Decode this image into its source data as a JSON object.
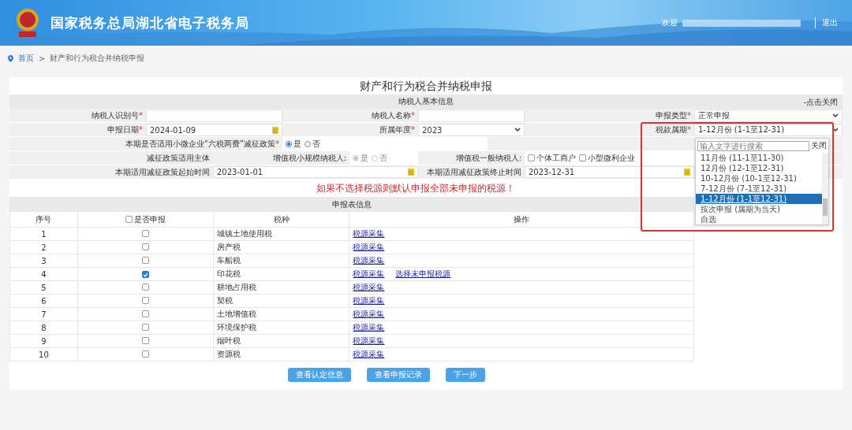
{
  "header": {
    "title": "国家税务总局湖北省电子税务局",
    "welcome": "欢迎",
    "logout": "退出"
  },
  "breadcrumb": {
    "home": "首页",
    "separator": ">",
    "current": "财产和行为税合并纳税申报"
  },
  "form": {
    "title": "财产和行为税合并纳税申报",
    "basic_info": {
      "title": "纳税人基本信息",
      "toggle": "-点击关闭",
      "fields": [
        {
          "label": "纳税人识别号",
          "mark": "*",
          "kind": "text"
        },
        {
          "label": "纳税人名称",
          "mark": "*",
          "kind": "text"
        },
        {
          "label": "申报类型",
          "mark": "*",
          "kind": "select",
          "value": "正常申报"
        },
        {
          "label": "申报日期",
          "mark": "*",
          "kind": "date",
          "value": "2024-01-09"
        },
        {
          "label": "所属年度",
          "mark": "*",
          "kind": "select",
          "value": "2023"
        },
        {
          "label": "税款属期",
          "mark": "*",
          "kind": "select",
          "value": "1-12月份 (1-1至12-31)",
          "highlighted": true
        },
        {
          "label": "本期是否适用小微企业“六税两费”减征政策",
          "mark": "*",
          "kind": "radio",
          "disabled": false,
          "options": [
            {
              "label": "是",
              "selected": true
            },
            {
              "label": "否",
              "selected": false
            }
          ]
        },
        {
          "label": "减征政策适用主体",
          "kind": "caption"
        },
        {
          "label": "增值税小规模纳税人:",
          "kind": "radio",
          "disabled": true,
          "options": [
            {
              "label": "是",
              "selected": true
            },
            {
              "label": "否",
              "selected": false
            }
          ]
        },
        {
          "label": "增值税一般纳税人:",
          "kind": "checkbox",
          "options": [
            {
              "label": "个体工商户",
              "checked": false
            },
            {
              "label": "小型微利企业",
              "checked": false
            }
          ]
        },
        {
          "label": "本期适用减征政策起始时间",
          "kind": "date",
          "value": "2023-01-01"
        },
        {
          "label": "本期适用减征政策终止时间",
          "kind": "date",
          "value": "2023-12-31"
        }
      ]
    },
    "period_dropdown": {
      "open": true,
      "search_placeholder": "输入文字进行搜索",
      "close": "关闭",
      "options": [
        {
          "label": "11月份 (11-1至11-30)",
          "selected": false
        },
        {
          "label": "12月份 (12-1至12-31)",
          "selected": false
        },
        {
          "label": "10-12月份 (10-1至12-31)",
          "selected": false
        },
        {
          "label": "7-12月份 (7-1至12-31)",
          "selected": false
        },
        {
          "label": "1-12月份 (1-1至12-31)",
          "selected": true
        },
        {
          "label": "按次申报 (属期为当天)",
          "selected": false
        },
        {
          "label": "自选",
          "selected": false
        }
      ]
    },
    "notice": "如果不选择税源则默认申报全部未申报的税源！",
    "table": {
      "title": "申报表信息",
      "columns": [
        {
          "label": "序号"
        },
        {
          "label": "是否申报",
          "kind": "checkbox",
          "checked": false
        },
        {
          "label": "税种"
        },
        {
          "label": "操作"
        }
      ],
      "rows": [
        {
          "no": "1",
          "checked": false,
          "tax": "城镇土地使用税",
          "actions": [
            "税源采集"
          ]
        },
        {
          "no": "2",
          "checked": false,
          "tax": "房产税",
          "actions": [
            "税源采集"
          ]
        },
        {
          "no": "3",
          "checked": false,
          "tax": "车船税",
          "actions": [
            "税源采集"
          ]
        },
        {
          "no": "4",
          "checked": true,
          "tax": "印花税",
          "actions": [
            "税源采集",
            "选择未申报税源"
          ]
        },
        {
          "no": "5",
          "checked": false,
          "tax": "耕地占用税",
          "actions": [
            "税源采集"
          ]
        },
        {
          "no": "6",
          "checked": false,
          "tax": "契税",
          "actions": [
            "税源采集"
          ]
        },
        {
          "no": "7",
          "checked": false,
          "tax": "土地增值税",
          "actions": [
            "税源采集"
          ]
        },
        {
          "no": "8",
          "checked": false,
          "tax": "环境保护税",
          "actions": [
            "税源采集"
          ]
        },
        {
          "no": "9",
          "checked": false,
          "tax": "烟叶税",
          "actions": [
            "税源采集"
          ]
        },
        {
          "no": "10",
          "checked": false,
          "tax": "资源税",
          "actions": [
            "税源采集"
          ]
        }
      ]
    },
    "buttons": [
      "查看认定信息",
      "查看申报记录",
      "下一步"
    ]
  }
}
